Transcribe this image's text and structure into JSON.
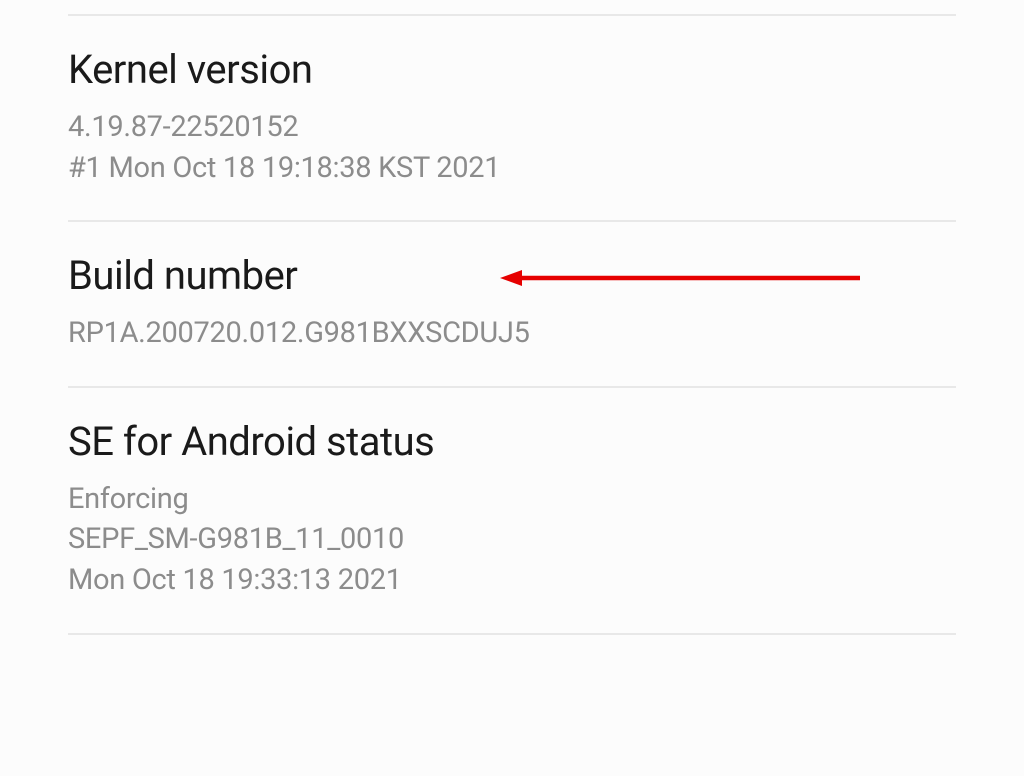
{
  "settings": {
    "kernel": {
      "title": "Kernel version",
      "line1": "4.19.87-22520152",
      "line2": "#1 Mon Oct 18 19:18:38 KST 2021"
    },
    "build": {
      "title": "Build number",
      "value": "RP1A.200720.012.G981BXXSCDUJ5"
    },
    "seandroid": {
      "title": "SE for Android status",
      "line1": "Enforcing",
      "line2": "SEPF_SM-G981B_11_0010",
      "line3": "Mon Oct 18 19:33:13 2021"
    }
  },
  "annotation": {
    "arrow_color": "#e60000"
  }
}
